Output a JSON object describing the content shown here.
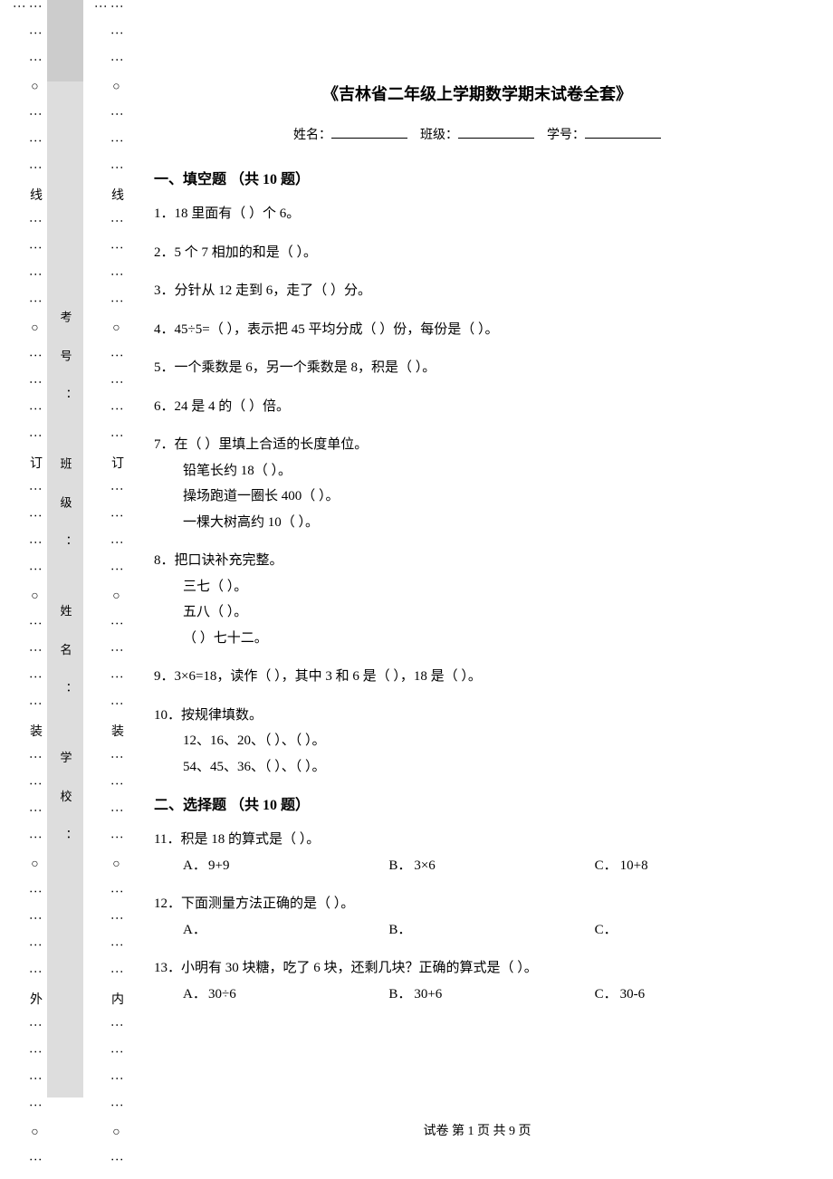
{
  "binding": {
    "outer_text": "⋮ ⋮ ⋮ ○ ⋮ ⋮ ⋮ 线 ⋮ ⋮ ⋮ ⋮ ○ ⋮ ⋮ ⋮ ⋮ 订 ⋮ ⋮ ⋮ ⋮ ○ ⋮ ⋮ ⋮ ⋮ 装 ⋮ ⋮ ⋮ ⋮ ○ ⋮ ⋮ ⋮ ⋮ 外 ⋮ ⋮ ⋮ ⋮ ○ ⋮ ⋮",
    "inner_text": "⋮ ⋮ ⋮ ○ ⋮ ⋮ ⋮ 线 ⋮ ⋮ ⋮ ⋮ ○ ⋮ ⋮ ⋮ ⋮ 订 ⋮ ⋮ ⋮ ⋮ ○ ⋮ ⋮ ⋮ ⋮ 装 ⋮ ⋮ ⋮ ⋮ ○ ⋮ ⋮ ⋮ ⋮ 内 ⋮ ⋮ ⋮ ⋮ ○ ⋮ ⋮",
    "mid_labels": "考号：  班级：  姓名：  学校："
  },
  "title": "《吉林省二年级上学期数学期末试卷全套》",
  "id_labels": {
    "name": "姓名：",
    "class": "班级：",
    "number": "学号："
  },
  "section1": {
    "heading": "一、填空题 （共 10 题）"
  },
  "q1": "1．18 里面有（  ）个 6。",
  "q2": "2．5 个 7 相加的和是（  ）。",
  "q3": "3．分针从 12 走到 6，走了（  ）分。",
  "q4": "4．45÷5=（  ），表示把 45 平均分成（  ）份，每份是（  ）。",
  "q5": "5．一个乘数是 6，另一个乘数是 8，积是（  ）。",
  "q6": "6．24 是 4 的（  ）倍。",
  "q7": {
    "stem": "7．在（  ）里填上合适的长度单位。",
    "a": "铅笔长约 18（  ）。",
    "b": "操场跑道一圈长 400（  ）。",
    "c": "一棵大树高约 10（  ）。"
  },
  "q8": {
    "stem": "8．把口诀补充完整。",
    "a": "三七（  ）。",
    "b": "五八（  ）。",
    "c": "（  ）七十二。"
  },
  "q9": "9．3×6=18，读作（  ），其中 3 和 6 是（  ），18 是（  ）。",
  "q10": {
    "stem": "10．按规律填数。",
    "a": "12、16、20、（  ）、（  ）。",
    "b": "54、45、36、（  ）、（  ）。"
  },
  "section2": {
    "heading": "二、选择题 （共 10 题）"
  },
  "q11": {
    "stem": "11．积是 18 的算式是（  ）。",
    "A_lbl": "A．",
    "A": "9+9",
    "B_lbl": "B．",
    "B": "3×6",
    "C_lbl": "C．",
    "C": "10+8"
  },
  "q12": {
    "stem": "12．下面测量方法正确的是（  ）。",
    "A_lbl": "A．",
    "B_lbl": "B．",
    "C_lbl": "C．"
  },
  "q13": {
    "stem": "13．小明有 30 块糖，吃了 6 块，还剩几块？正确的算式是（  ）。",
    "A_lbl": "A．",
    "A": "30÷6",
    "B_lbl": "B．",
    "B": "30+6",
    "C_lbl": "C．",
    "C": "30-6"
  },
  "footer": "试卷 第 1 页 共 9 页"
}
